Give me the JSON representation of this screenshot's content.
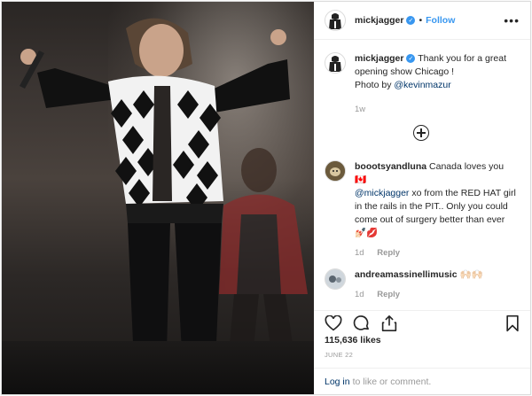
{
  "post": {
    "username": "mickjagger",
    "follow_label": "Follow",
    "separator": "•",
    "more_label": "•••"
  },
  "caption": {
    "username": "mickjagger",
    "text": "Thank you for a great opening show Chicago !",
    "line2_prefix": "Photo by",
    "mention": "@kevinmazur",
    "time": "1w"
  },
  "comments": [
    {
      "username": "boootsyandluna",
      "text_before": "Canada loves you 🇨🇦",
      "mention": "@mickjagger",
      "text_after": "xo from the RED HAT girl in the rails in the PIT.. Only you could come out of surgery better than ever 💅🏻💋",
      "time": "1d",
      "reply_label": "Reply"
    },
    {
      "username": "andreamassinellimusic",
      "text": "🙌🏻🙌🏻",
      "time": "1d",
      "reply_label": "Reply"
    }
  ],
  "likes": "115,636 likes",
  "date": "JUNE 22",
  "login": {
    "link_label": "Log in",
    "rest": "to like or comment."
  },
  "icons": {
    "like": "heart-icon",
    "comment": "comment-icon",
    "share": "share-icon",
    "save": "bookmark-icon",
    "load_more": "plus-circle-icon",
    "verified": "verified-badge-icon"
  },
  "colors": {
    "link_blue": "#3897f0",
    "mention": "#003569",
    "muted": "#999999"
  }
}
